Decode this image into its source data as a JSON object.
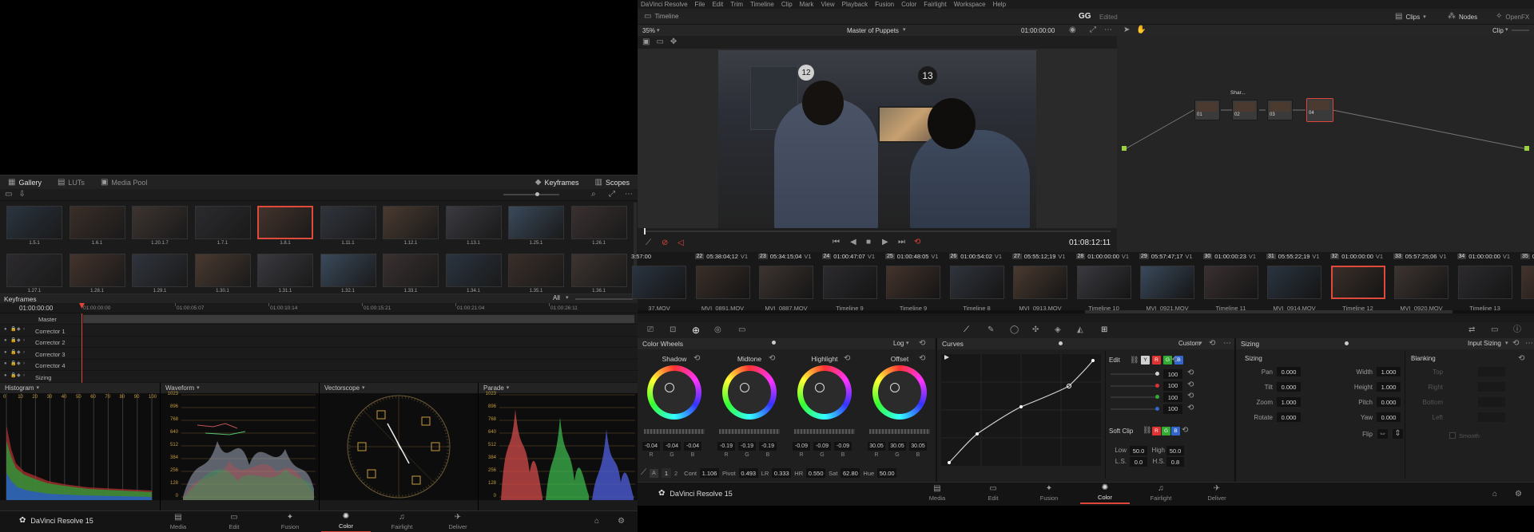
{
  "left": {
    "gallery_tabs": [
      {
        "label": "Gallery",
        "icon": "gallery-icon",
        "active": true
      },
      {
        "label": "LUTs",
        "icon": "luts-icon",
        "active": false
      },
      {
        "label": "Media Pool",
        "icon": "media-pool-icon",
        "active": false
      }
    ],
    "right_tabs": [
      {
        "label": "Keyframes",
        "icon": "keyframes-icon"
      },
      {
        "label": "Scopes",
        "icon": "scopes-icon"
      }
    ],
    "stills_row1": [
      "1.5.1",
      "1.6.1",
      "1.20.1.7",
      "1.7.1",
      "1.8.1",
      "1.11.1",
      "1.12.1",
      "1.13.1",
      "1.25.1",
      "1.26.1"
    ],
    "stills_row2": [
      "1.27.1",
      "1.28.1",
      "1.29.1",
      "1.30.1",
      "1.31.1",
      "1.32.1",
      "1.33.1",
      "1.34.1",
      "1.35.1",
      "1.36.1"
    ],
    "selected_still": "1.8.1",
    "keyframes": {
      "title": "Keyframes",
      "filter": "All",
      "timecode": "01:00:00:00",
      "ruler": [
        "01:00:00:00",
        "01:00:05:07",
        "01:00:10:14",
        "01:00:15:21",
        "01:00:21:04",
        "01:00:26:11"
      ],
      "tracks": [
        "Master",
        "Corrector 1",
        "Corrector 2",
        "Corrector 3",
        "Corrector 4",
        "Sizing"
      ]
    },
    "scopes": {
      "histogram": "Histogram",
      "waveform": "Waveform",
      "vectorscope": "Vectorscope",
      "parade": "Parade",
      "hist_x": [
        "0",
        "10",
        "20",
        "30",
        "40",
        "50",
        "60",
        "70",
        "80",
        "90",
        "100"
      ],
      "levels": [
        "1023",
        "896",
        "768",
        "640",
        "512",
        "384",
        "256",
        "128",
        "0"
      ]
    },
    "brand": "DaVinci Resolve 15",
    "pages": [
      {
        "label": "Media",
        "icon": "media-icon"
      },
      {
        "label": "Edit",
        "icon": "edit-icon"
      },
      {
        "label": "Fusion",
        "icon": "fusion-icon"
      },
      {
        "label": "Color",
        "icon": "color-icon",
        "active": true
      },
      {
        "label": "Fairlight",
        "icon": "fairlight-icon"
      },
      {
        "label": "Deliver",
        "icon": "deliver-icon"
      }
    ]
  },
  "right": {
    "menus": [
      "DaVinci Resolve",
      "File",
      "Edit",
      "Trim",
      "Timeline",
      "Clip",
      "Mark",
      "View",
      "Playback",
      "Fusion",
      "Color",
      "Fairlight",
      "Workspace",
      "Help"
    ],
    "timeline_btn": "Timeline",
    "project": "GG",
    "project_status": "Edited",
    "top_right": [
      "Clips",
      "Nodes",
      "OpenFX"
    ],
    "viewer": {
      "zoom": "35%",
      "clip_name": "Master of Puppets",
      "timecode": "01:00:00:00",
      "playhead_tc": "01:08:12:11"
    },
    "nodes_hdr": "Clip",
    "nodes": [
      {
        "label": "01"
      },
      {
        "label": "02",
        "title": "Shar..."
      },
      {
        "label": "03"
      },
      {
        "label": "04"
      }
    ],
    "clips": [
      {
        "num": "",
        "tc": "3:57:00",
        "track": "",
        "name": "37.MOV"
      },
      {
        "num": "22",
        "tc": "05:38:04;12",
        "track": "V1",
        "name": "MVI_0891.MOV"
      },
      {
        "num": "23",
        "tc": "05:34:15;04",
        "track": "V1",
        "name": "MVI_0887.MOV"
      },
      {
        "num": "24",
        "tc": "01:00:47:07",
        "track": "V1",
        "name": "Timeline 9"
      },
      {
        "num": "25",
        "tc": "01:00:48:05",
        "track": "V1",
        "name": "Timeline 9"
      },
      {
        "num": "26",
        "tc": "01:00:54:02",
        "track": "V1",
        "name": "Timeline 8"
      },
      {
        "num": "27",
        "tc": "05:55:12;19",
        "track": "V1",
        "name": "MVI_0913.MOV"
      },
      {
        "num": "28",
        "tc": "01:00:00:00",
        "track": "V1",
        "name": "Timeline 10"
      },
      {
        "num": "29",
        "tc": "05:57:47;17",
        "track": "V1",
        "name": "MVI_0921.MOV"
      },
      {
        "num": "30",
        "tc": "01:00:00:23",
        "track": "V1",
        "name": "Timeline 11"
      },
      {
        "num": "31",
        "tc": "05:55:22;19",
        "track": "V1",
        "name": "MVI_0914.MOV"
      },
      {
        "num": "32",
        "tc": "01:00:00:00",
        "track": "V1",
        "name": "Timeline 12"
      },
      {
        "num": "33",
        "tc": "05:57:25;06",
        "track": "V1",
        "name": "MVI_0920.MOV"
      },
      {
        "num": "34",
        "tc": "01:00:00:00",
        "track": "V1",
        "name": "Timeline 13"
      },
      {
        "num": "35",
        "tc": "01",
        "track": "",
        "name": ""
      }
    ],
    "selected_clip": "32",
    "color_wheels": {
      "title": "Color Wheels",
      "mode": "Log",
      "wheels": [
        {
          "name": "Shadow",
          "values": [
            "-0.04",
            "-0.04",
            "-0.04"
          ]
        },
        {
          "name": "Midtone",
          "values": [
            "-0.19",
            "-0.19",
            "-0.19"
          ]
        },
        {
          "name": "Highlight",
          "values": [
            "-0.09",
            "-0.09",
            "-0.09"
          ]
        },
        {
          "name": "Offset",
          "values": [
            "30.05",
            "30.05",
            "30.05"
          ]
        }
      ],
      "rgb": [
        "R",
        "G",
        "B"
      ],
      "bottom": {
        "page1": "1",
        "page2": "2",
        "cont_label": "Cont",
        "cont": "1.106",
        "pivot_label": "Pivot",
        "pivot": "0.493",
        "lr_label": "LR",
        "lr": "0.333",
        "hr_label": "HR",
        "hr": "0.550",
        "sat_label": "Sat",
        "sat": "62.80",
        "hue_label": "Hue",
        "hue": "50.00"
      }
    },
    "curves": {
      "title": "Curves",
      "mode": "Custom",
      "edit_label": "Edit",
      "edit_values": [
        "100",
        "100",
        "100",
        "100"
      ],
      "soft_clip": "Soft Clip",
      "low_label": "Low",
      "low": "50.0",
      "high_label": "High",
      "high": "50.0",
      "ls_label": "L.S.",
      "ls": "0.0",
      "hs_label": "H.S.",
      "hs": "0.8",
      "channels": [
        "Y",
        "R",
        "G",
        "B"
      ]
    },
    "sizing": {
      "title": "Sizing",
      "mode": "Input Sizing",
      "section": "Sizing",
      "left_fields": [
        {
          "label": "Pan",
          "value": "0.000"
        },
        {
          "label": "Tilt",
          "value": "0.000"
        },
        {
          "label": "Zoom",
          "value": "1.000"
        },
        {
          "label": "Rotate",
          "value": "0.000"
        }
      ],
      "right_fields": [
        {
          "label": "Width",
          "value": "1.000"
        },
        {
          "label": "Height",
          "value": "1.000"
        },
        {
          "label": "Pitch",
          "value": "0.000"
        },
        {
          "label": "Yaw",
          "value": "0.000"
        }
      ],
      "flip": "Flip",
      "blanking": "Blanking",
      "blanking_fields": [
        "Top",
        "Right",
        "Bottom",
        "Left"
      ],
      "smooth": "Smooth"
    },
    "brand": "DaVinci Resolve 15"
  },
  "colors": {
    "accent": "#e0453a",
    "bg": "#1a1a1a",
    "panel": "#1f1f1f",
    "scope_label": "#c49a3a"
  }
}
